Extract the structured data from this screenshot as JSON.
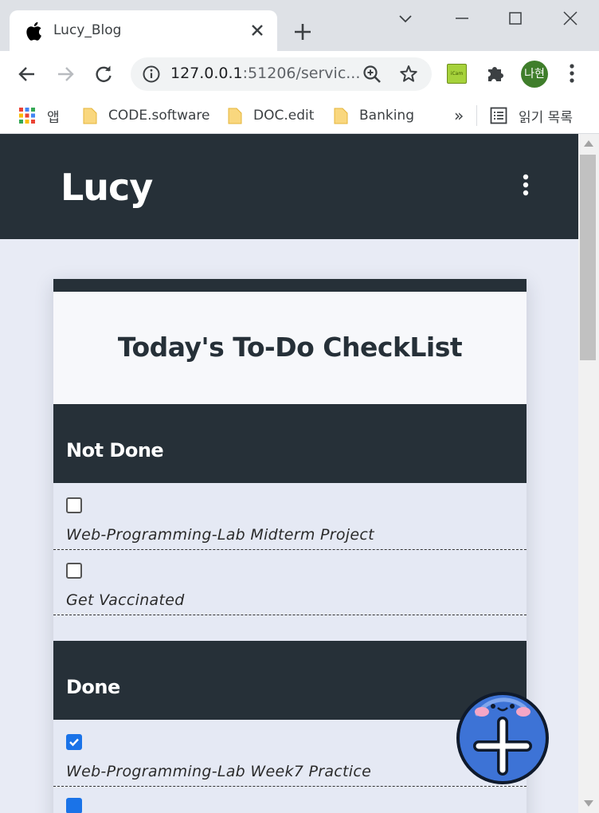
{
  "browser": {
    "tab_title": "Lucy_Blog",
    "url_host": "127.0.0.1",
    "url_rest": ":51206/servic...",
    "profile_initials": "나현",
    "ext_label": "iCam"
  },
  "bookmarks": [
    {
      "label": "앱"
    },
    {
      "label": "CODE.software"
    },
    {
      "label": "DOC.edit"
    },
    {
      "label": "Banking"
    }
  ],
  "bookmarks_overflow": "»",
  "reading_list": "읽기 목록",
  "site": {
    "logo": "Lucy"
  },
  "checklist": {
    "title": "Today's To-Do CheckList",
    "not_done_label": "Not Done",
    "done_label": "Done",
    "not_done_items": [
      {
        "text": "Web-Programming-Lab Midterm Project",
        "checked": false
      },
      {
        "text": "Get Vaccinated",
        "checked": false
      }
    ],
    "done_items": [
      {
        "text": "Web-Programming-Lab Week7 Practice",
        "checked": true
      }
    ]
  },
  "colors": {
    "header": "#263038",
    "page_bg": "#e8ebf5",
    "check_blue": "#1a73e8",
    "fab_blue": "#3d73d6"
  }
}
